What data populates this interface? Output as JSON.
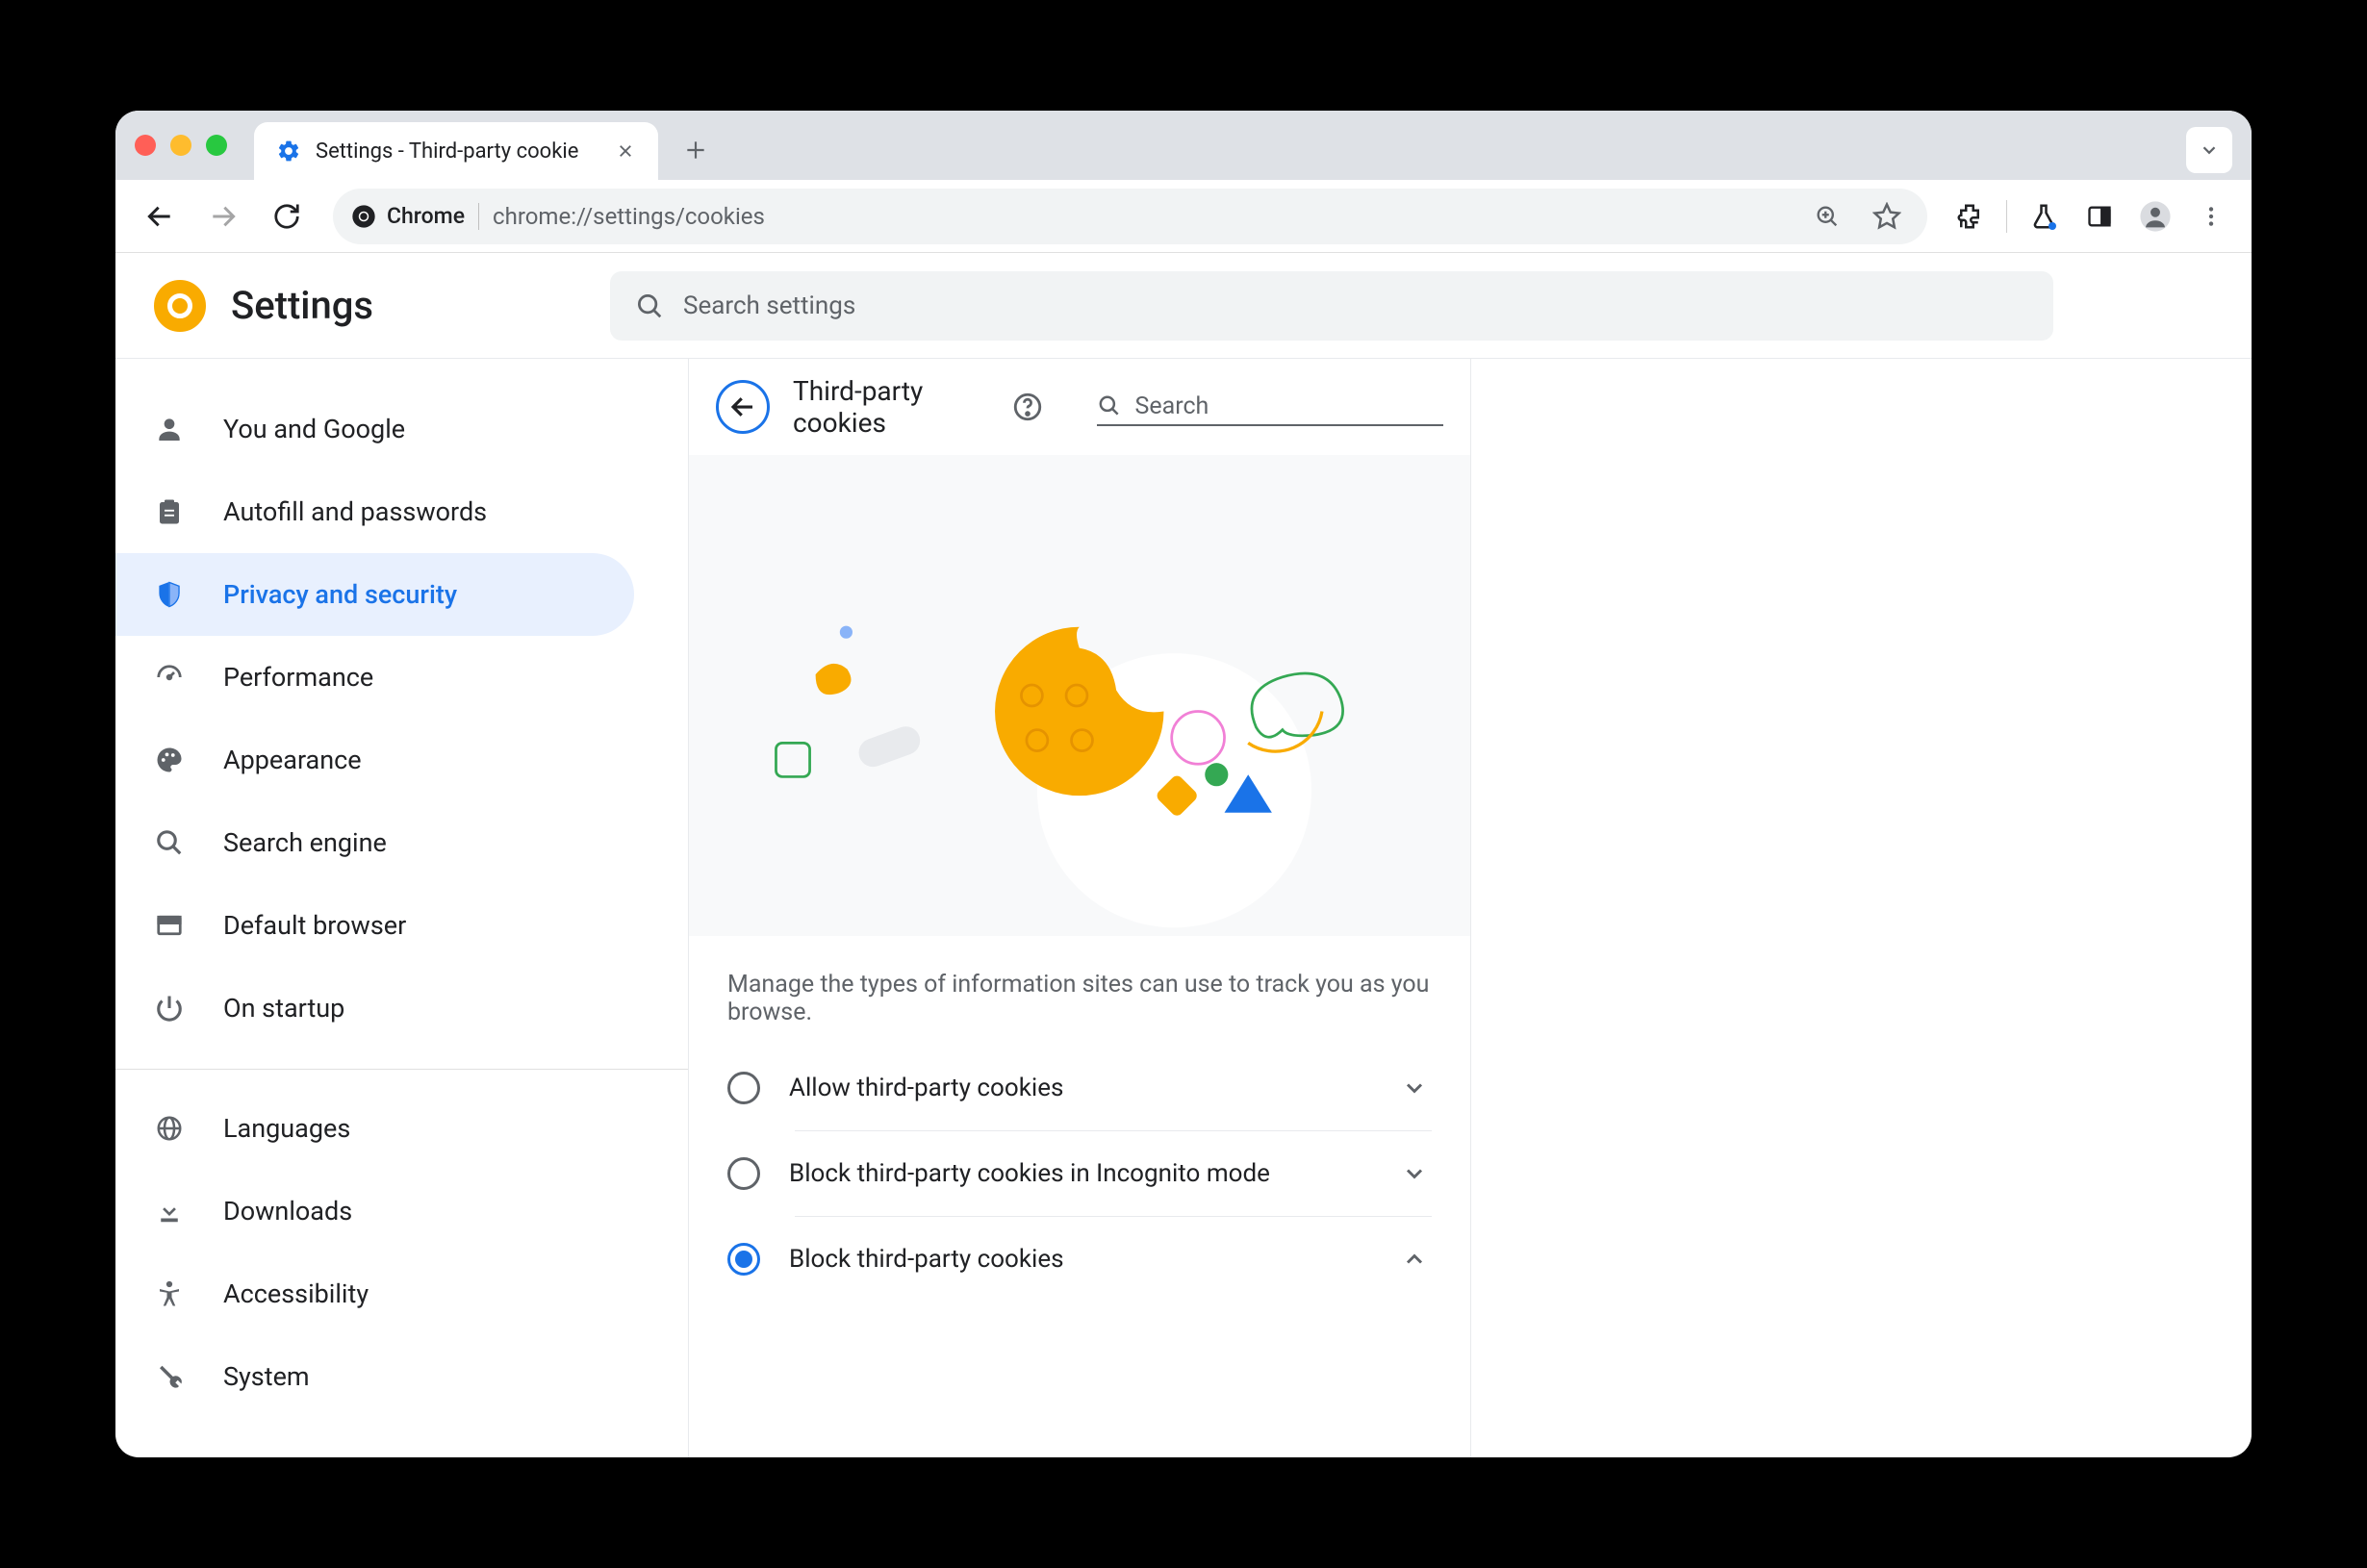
{
  "tab": {
    "title": "Settings - Third-party cookie"
  },
  "omnibox": {
    "chip": "Chrome",
    "url": "chrome://settings/cookies"
  },
  "app": {
    "title": "Settings",
    "search_placeholder": "Search settings"
  },
  "sidebar": {
    "section1": [
      {
        "label": "You and Google"
      },
      {
        "label": "Autofill and passwords"
      },
      {
        "label": "Privacy and security"
      },
      {
        "label": "Performance"
      },
      {
        "label": "Appearance"
      },
      {
        "label": "Search engine"
      },
      {
        "label": "Default browser"
      },
      {
        "label": "On startup"
      }
    ],
    "section2": [
      {
        "label": "Languages"
      },
      {
        "label": "Downloads"
      },
      {
        "label": "Accessibility"
      },
      {
        "label": "System"
      }
    ]
  },
  "panel": {
    "title": "Third-party cookies",
    "search_placeholder": "Search",
    "description": "Manage the types of information sites can use to track you as you browse.",
    "options": [
      {
        "label": "Allow third-party cookies",
        "selected": false,
        "expanded": false
      },
      {
        "label": "Block third-party cookies in Incognito mode",
        "selected": false,
        "expanded": false
      },
      {
        "label": "Block third-party cookies",
        "selected": true,
        "expanded": true
      }
    ]
  }
}
